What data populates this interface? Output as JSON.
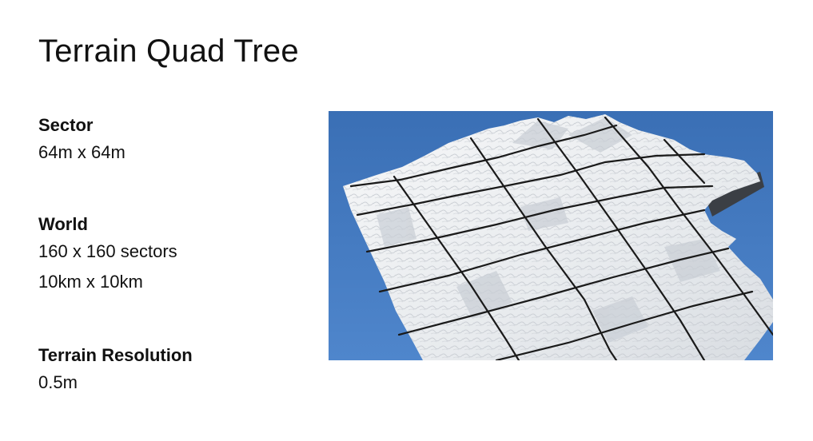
{
  "title": "Terrain Quad Tree",
  "sections": [
    {
      "heading": "Sector",
      "lines": [
        "64m x 64m"
      ]
    },
    {
      "heading": "World",
      "lines": [
        "160 x 160 sectors",
        "10km x 10km"
      ]
    },
    {
      "heading": "Terrain Resolution",
      "lines": [
        "0.5m"
      ]
    }
  ],
  "figure": {
    "subject": "snowy-terrain-render-with-quad-tree-sector-grid",
    "sky_color": "#3f74b9",
    "terrain_color": "#eef0f2",
    "grid_color": "#1a1a1a"
  }
}
